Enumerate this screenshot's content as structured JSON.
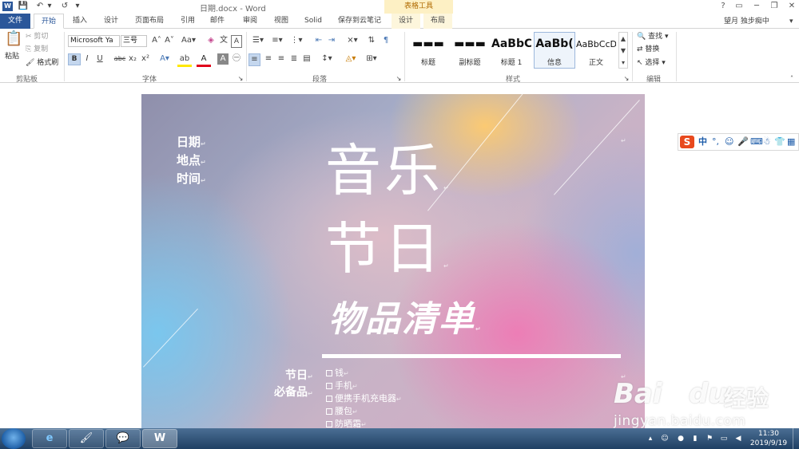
{
  "window": {
    "title": "日期.docx - Word",
    "context_header": "表格工具",
    "help": "?",
    "controls": [
      "▭",
      "─",
      "❐",
      "✕"
    ]
  },
  "quick_access": {
    "word_logo": "W",
    "save": "💾",
    "undo": "↶",
    "undo_more": "▾",
    "redo": "↺",
    "customize": "▾"
  },
  "tabs": [
    "文件",
    "开始",
    "插入",
    "设计",
    "页面布局",
    "引用",
    "邮件",
    "审阅",
    "视图",
    "Solid",
    "保存到云笔记",
    "设计",
    "布局"
  ],
  "user": {
    "name": "望月 独步痴中",
    "caret": "▾"
  },
  "ribbon": {
    "clipboard": {
      "paste": "粘贴",
      "cut": "剪切",
      "copy": "复制",
      "format_painter": "格式刷",
      "label": "剪贴板"
    },
    "font": {
      "name": "Microsoft Ya",
      "size": "三号",
      "label": "字体",
      "buttons": [
        "B",
        "I",
        "U",
        "abc",
        "x₂",
        "x²"
      ]
    },
    "paragraph": {
      "label": "段落"
    },
    "styles": {
      "label": "样式",
      "items": [
        {
          "sample": "▬▬▬",
          "name": "标题"
        },
        {
          "sample": "▬▬▬",
          "name": "副标题"
        },
        {
          "sample": "AaBbC",
          "name": "标题 1"
        },
        {
          "sample": "AaBb(",
          "name": "信息"
        },
        {
          "sample": "AaBbCcD",
          "name": "正文"
        }
      ]
    },
    "editing": {
      "find": "查找",
      "replace": "替换",
      "select": "选择",
      "label": "编辑"
    }
  },
  "document": {
    "meta": [
      "日期",
      "地点",
      "时间"
    ],
    "title_line1": "音乐",
    "title_line2": "节日",
    "subtitle": "物品清单",
    "left_label_1": "节日",
    "left_label_2": "必备品",
    "checklist": [
      "钱",
      "手机",
      "便携手机充电器",
      "腰包",
      "防晒霜"
    ],
    "para_mark": "↵"
  },
  "ime": {
    "logo": "S",
    "lang": "中",
    "items": [
      "°,",
      "☺",
      "🎤",
      "⌨",
      "👕",
      "▦"
    ]
  },
  "watermark": {
    "brand": "Bai",
    "brand_end": "du",
    "cn": "经验",
    "url": "jingyan.baidu.com"
  },
  "taskbar": {
    "time": "11:30",
    "date": "2019/9/19",
    "apps": [
      "e",
      "🖌",
      "💬",
      "W"
    ]
  }
}
